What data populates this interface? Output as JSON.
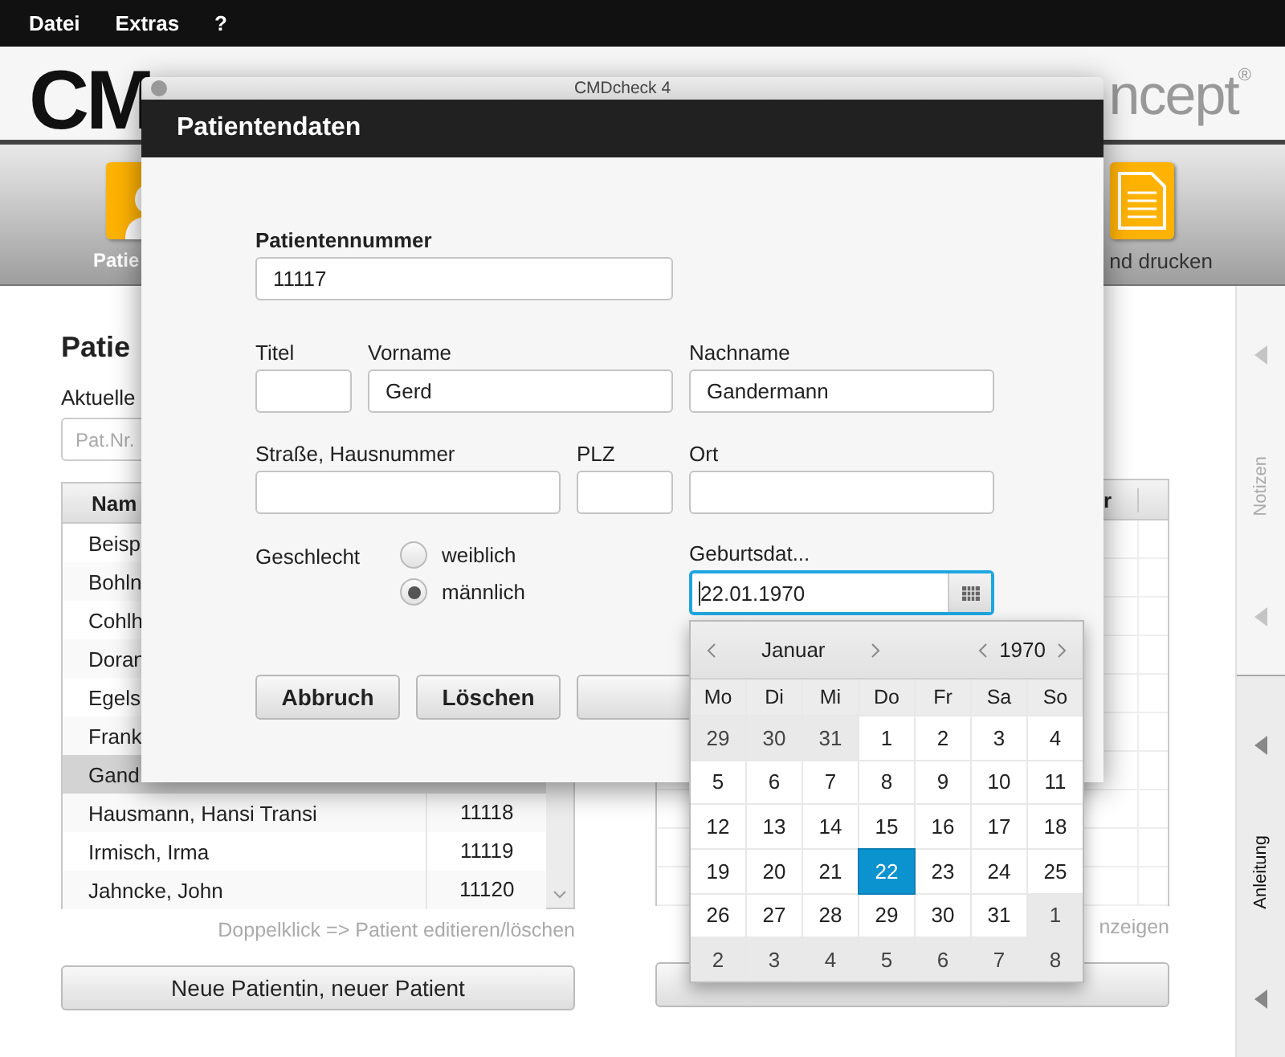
{
  "menu": [
    "Datei",
    "Extras",
    "?"
  ],
  "header": {
    "logo_left": "CM",
    "logo_right": "ncept",
    "registered": "®"
  },
  "toolbar": [
    {
      "label": "Patie",
      "kind": "person"
    },
    {
      "label": "nd drucken",
      "kind": "document"
    }
  ],
  "left_panel": {
    "heading": "Patie",
    "search_label": "Aktuelle",
    "search": {
      "placeholder": "Pat.Nr."
    },
    "table": {
      "column_1": "Nam",
      "rows": [
        {
          "name": "Beisp",
          "selected": false
        },
        {
          "name": "Bohln",
          "selected": false
        },
        {
          "name": "Cohlh",
          "selected": false
        },
        {
          "name": "Doran",
          "selected": false
        },
        {
          "name": "Egels",
          "selected": false
        },
        {
          "name": "Frank",
          "selected": false
        },
        {
          "name": "Gand",
          "selected": true
        },
        {
          "name": "Hausmann, Hansi Transi",
          "number": "11118",
          "selected": false
        },
        {
          "name": "Irmisch, Irma",
          "number": "11119",
          "selected": false
        },
        {
          "name": "Jahncke, John",
          "number": "11120",
          "selected": false
        }
      ]
    },
    "hint": "Doppelklick => Patient editieren/löschen",
    "button": "Neue Patientin, neuer Patient"
  },
  "right_panel": {
    "table": {
      "column_1": "r"
    },
    "hint": "nzeigen"
  },
  "side_tabs": [
    {
      "label": "Notizen",
      "selected": false
    },
    {
      "label": "Anleitung",
      "selected": true
    }
  ],
  "dialog": {
    "window_title": "CMDcheck 4",
    "title": "Patientendaten",
    "patient_number": {
      "label": "Patientennummer",
      "value": "11117"
    },
    "titel": {
      "label": "Titel"
    },
    "vorname": {
      "label": "Vorname",
      "value": "Gerd"
    },
    "nachname": {
      "label": "Nachname",
      "value": "Gandermann"
    },
    "strasse": {
      "label": "Straße, Hausnummer"
    },
    "plz": {
      "label": "PLZ"
    },
    "ort": {
      "label": "Ort"
    },
    "gender": {
      "label": "Geschlecht",
      "options": [
        {
          "label": "weiblich",
          "selected": false
        },
        {
          "label": "männlich",
          "selected": true
        }
      ]
    },
    "birthdate": {
      "label": "Geburtsdat...",
      "value": "22.01.1970",
      "focused": true
    },
    "buttons": [
      "Abbruch",
      "Löschen"
    ]
  },
  "calendar": {
    "month": "Januar",
    "year": "1970",
    "weekdays": [
      "Mo",
      "Di",
      "Mi",
      "Do",
      "Fr",
      "Sa",
      "So"
    ],
    "days": [
      {
        "day": "29",
        "in_month": false,
        "selected": false
      },
      {
        "day": "30",
        "in_month": false,
        "selected": false
      },
      {
        "day": "31",
        "in_month": false,
        "selected": false
      },
      {
        "day": "1",
        "in_month": true,
        "selected": false
      },
      {
        "day": "2",
        "in_month": true,
        "selected": false
      },
      {
        "day": "3",
        "in_month": true,
        "selected": false
      },
      {
        "day": "4",
        "in_month": true,
        "selected": false
      },
      {
        "day": "5",
        "in_month": true,
        "selected": false
      },
      {
        "day": "6",
        "in_month": true,
        "selected": false
      },
      {
        "day": "7",
        "in_month": true,
        "selected": false
      },
      {
        "day": "8",
        "in_month": true,
        "selected": false
      },
      {
        "day": "9",
        "in_month": true,
        "selected": false
      },
      {
        "day": "10",
        "in_month": true,
        "selected": false
      },
      {
        "day": "11",
        "in_month": true,
        "selected": false
      },
      {
        "day": "12",
        "in_month": true,
        "selected": false
      },
      {
        "day": "13",
        "in_month": true,
        "selected": false
      },
      {
        "day": "14",
        "in_month": true,
        "selected": false
      },
      {
        "day": "15",
        "in_month": true,
        "selected": false
      },
      {
        "day": "16",
        "in_month": true,
        "selected": false
      },
      {
        "day": "17",
        "in_month": true,
        "selected": false
      },
      {
        "day": "18",
        "in_month": true,
        "selected": false
      },
      {
        "day": "19",
        "in_month": true,
        "selected": false
      },
      {
        "day": "20",
        "in_month": true,
        "selected": false
      },
      {
        "day": "21",
        "in_month": true,
        "selected": false
      },
      {
        "day": "22",
        "in_month": true,
        "selected": true
      },
      {
        "day": "23",
        "in_month": true,
        "selected": false
      },
      {
        "day": "24",
        "in_month": true,
        "selected": false
      },
      {
        "day": "25",
        "in_month": true,
        "selected": false
      },
      {
        "day": "26",
        "in_month": true,
        "selected": false
      },
      {
        "day": "27",
        "in_month": true,
        "selected": false
      },
      {
        "day": "28",
        "in_month": true,
        "selected": false
      },
      {
        "day": "29",
        "in_month": true,
        "selected": false
      },
      {
        "day": "30",
        "in_month": true,
        "selected": false
      },
      {
        "day": "31",
        "in_month": true,
        "selected": false
      },
      {
        "day": "1",
        "in_month": false,
        "selected": false
      },
      {
        "day": "2",
        "in_month": false,
        "selected": false
      },
      {
        "day": "3",
        "in_month": false,
        "selected": false
      },
      {
        "day": "4",
        "in_month": false,
        "selected": false
      },
      {
        "day": "5",
        "in_month": false,
        "selected": false
      },
      {
        "day": "6",
        "in_month": false,
        "selected": false
      },
      {
        "day": "7",
        "in_month": false,
        "selected": false
      },
      {
        "day": "8",
        "in_month": false,
        "selected": false
      }
    ]
  }
}
